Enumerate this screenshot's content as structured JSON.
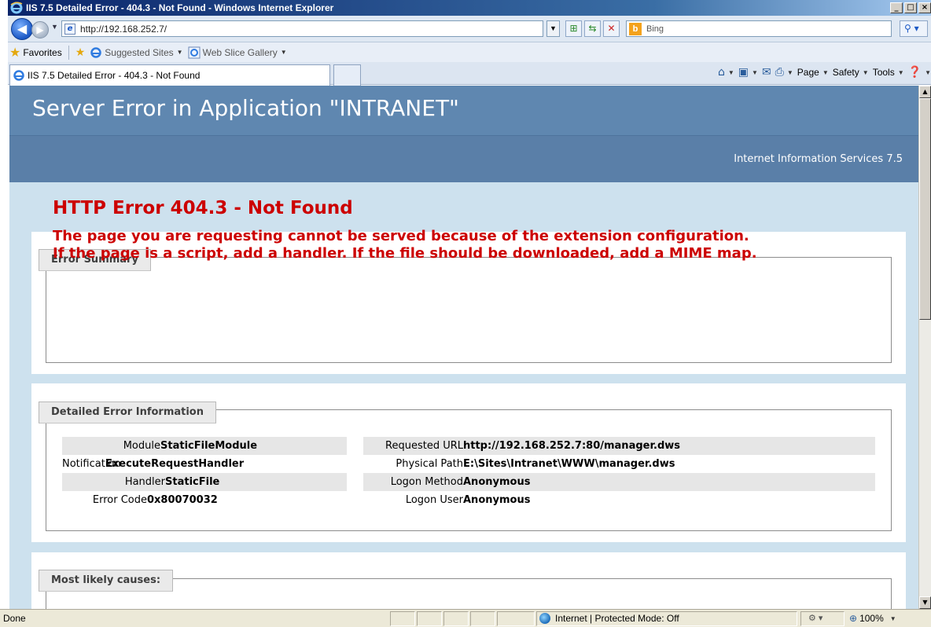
{
  "window": {
    "title": "IIS 7.5 Detailed Error - 404.3 - Not Found - Windows Internet Explorer",
    "minimize": "_",
    "maximize": "□",
    "close": "×"
  },
  "address": {
    "url": "http://192.168.252.7/",
    "search_provider": "Bing"
  },
  "favorites": {
    "label": "Favorites",
    "links": [
      "Suggested Sites",
      "Web Slice Gallery"
    ]
  },
  "tabs": [
    {
      "label": "IIS 7.5 Detailed Error - 404.3 - Not Found"
    }
  ],
  "command_bar": {
    "page": "Page",
    "safety": "Safety",
    "tools": "Tools"
  },
  "page": {
    "header": "Server Error in Application \"INTRANET\"",
    "server_version": "Internet Information Services 7.5",
    "error_summary": {
      "legend": "Error Summary",
      "title": "HTTP Error 404.3 - Not Found",
      "message_line1": "The page you are requesting cannot be served because of the extension configuration.",
      "message_line2": "If the page is a script, add a handler. If the file should be downloaded, add a MIME map."
    },
    "detailed": {
      "legend": "Detailed Error Information",
      "left": [
        {
          "label": "Module",
          "value": "StaticFileModule"
        },
        {
          "label": "Notification",
          "value": "ExecuteRequestHandler"
        },
        {
          "label": "Handler",
          "value": "StaticFile"
        },
        {
          "label": "Error Code",
          "value": "0x80070032"
        }
      ],
      "right": [
        {
          "label": "Requested URL",
          "value": "http://192.168.252.7:80/manager.dws"
        },
        {
          "label": "Physical Path",
          "value": "E:\\Sites\\Intranet\\WWW\\manager.dws"
        },
        {
          "label": "Logon Method",
          "value": "Anonymous"
        },
        {
          "label": "Logon User",
          "value": "Anonymous"
        }
      ]
    },
    "causes": {
      "legend": "Most likely causes:"
    }
  },
  "status": {
    "text": "Done",
    "zone": "Internet | Protected Mode: Off",
    "zoom": "100%"
  },
  "colors": {
    "header_bg": "#5f87b0",
    "error_red": "#cc0000",
    "page_bg": "#cde1ee"
  }
}
